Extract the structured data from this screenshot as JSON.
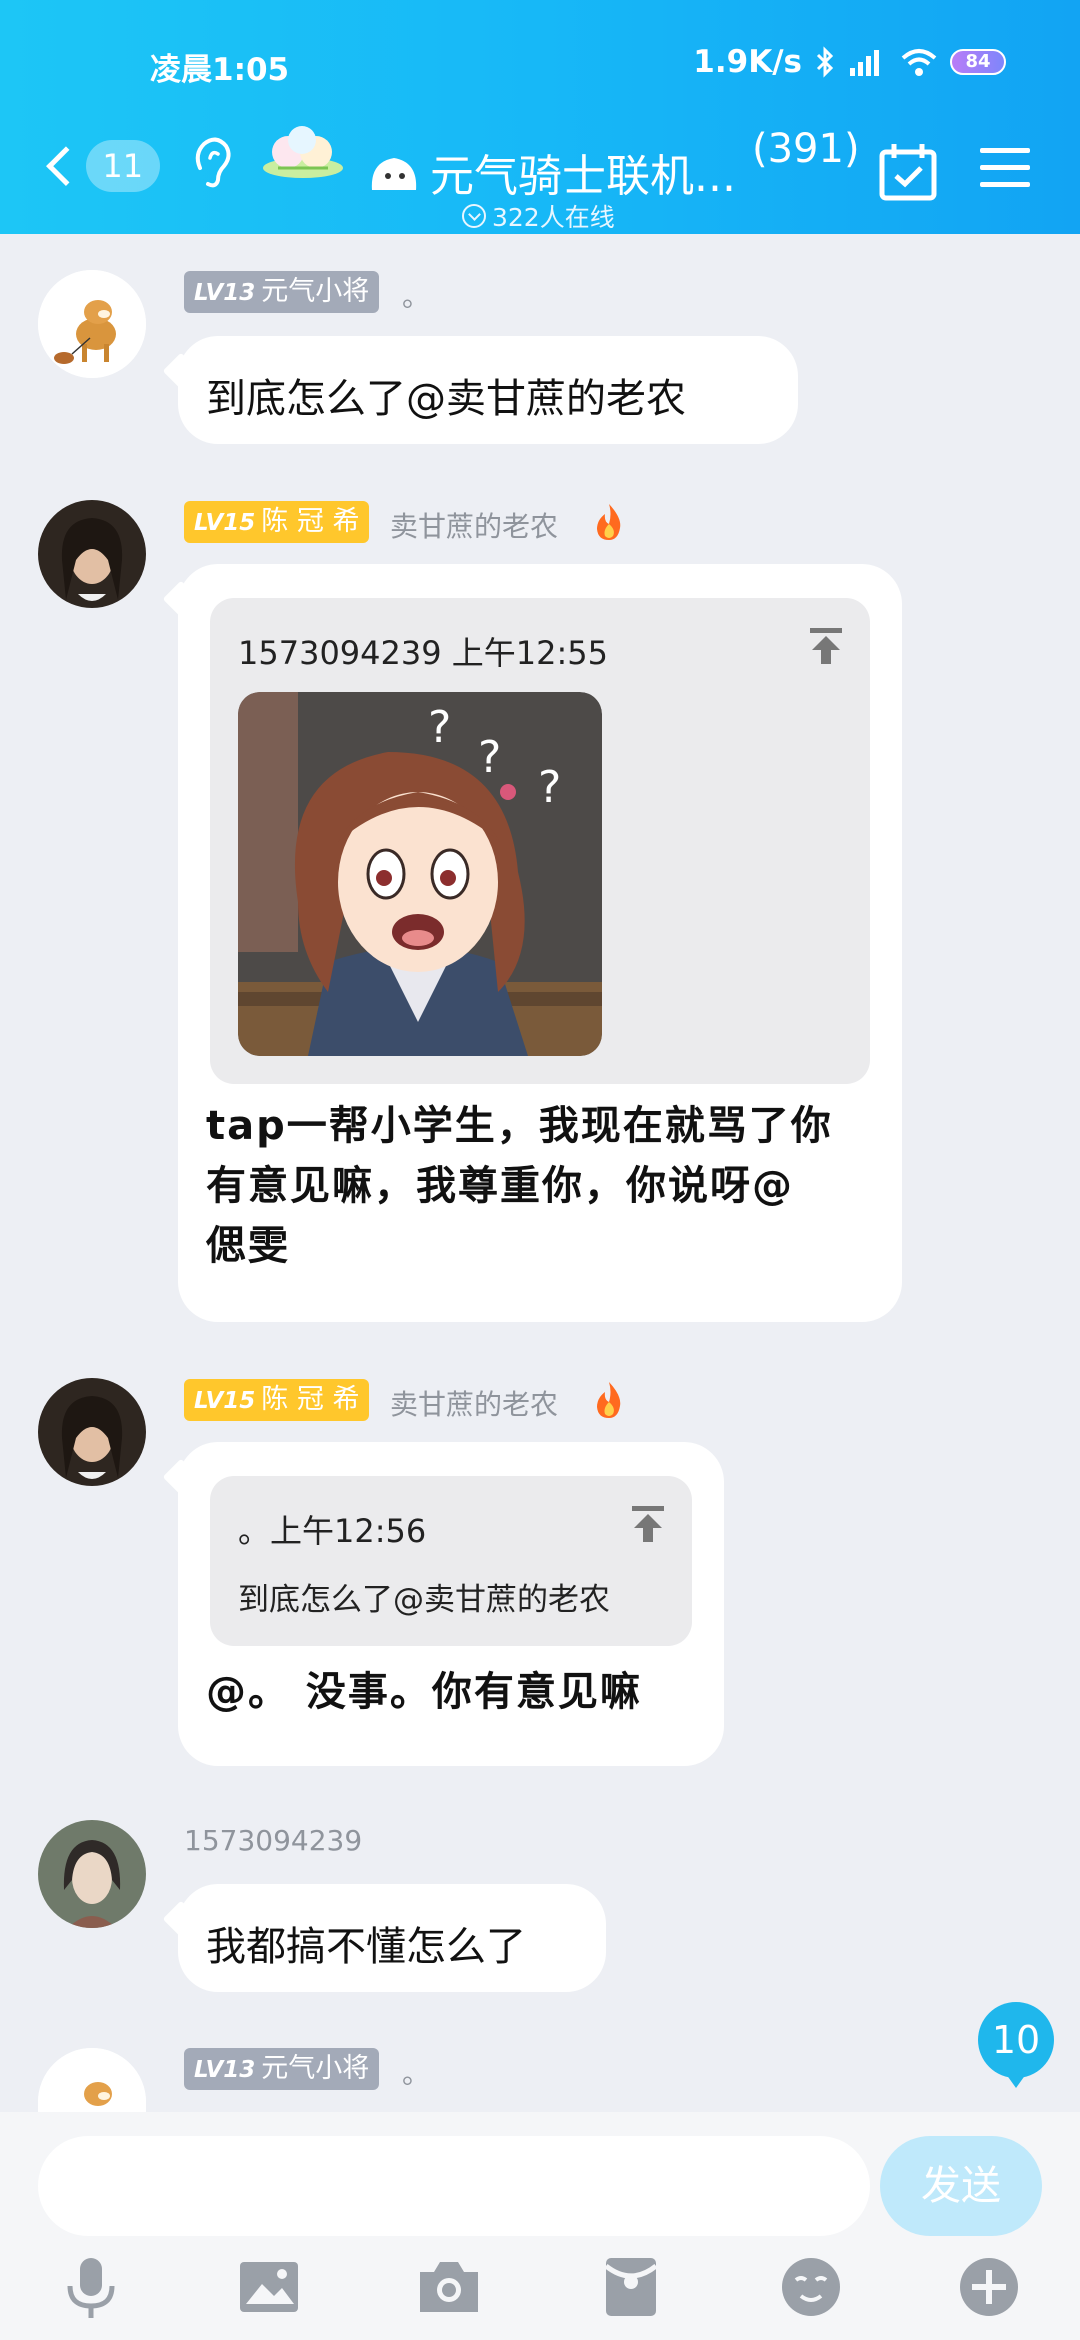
{
  "status_bar": {
    "time": "凌晨1:05",
    "network_speed": "1.9K/s",
    "battery": "84"
  },
  "header": {
    "back_unread": "11",
    "title": "元气骑士联机...",
    "member_count": "(391)",
    "online": "322人在线"
  },
  "messages": [
    {
      "level": "LV13",
      "title": "元气小将",
      "nickname": "。",
      "text": "到底怎么了@卖甘蔗的老农"
    },
    {
      "level": "LV15",
      "title": "陈 冠 希",
      "nickname": "卖甘蔗的老农",
      "quote": {
        "header": "1573094239 上午12:55"
      },
      "text_lines": [
        "tap一帮小学生，我现在就骂了你",
        "有意见嘛，我尊重你，你说呀@",
        "偲雯"
      ]
    },
    {
      "level": "LV15",
      "title": "陈 冠 希",
      "nickname": "卖甘蔗的老农",
      "quote": {
        "header": "。上午12:56",
        "text": "到底怎么了@卖甘蔗的老农"
      },
      "text": "@。 没事。你有意见嘛"
    },
    {
      "nickname": "1573094239",
      "text": "我都搞不懂怎么了"
    },
    {
      "level": "LV13",
      "title": "元气小将",
      "nickname": "。"
    }
  ],
  "unread_badge": "10",
  "input": {
    "placeholder": "",
    "send_label": "发送"
  },
  "colors": {
    "header_gradient_start": "#1dc6f6",
    "header_gradient_end": "#12a4f3",
    "gold_tag": "#ffc72c",
    "gray_tag": "#a3aab8",
    "accent_badge": "#1fb7ec"
  }
}
